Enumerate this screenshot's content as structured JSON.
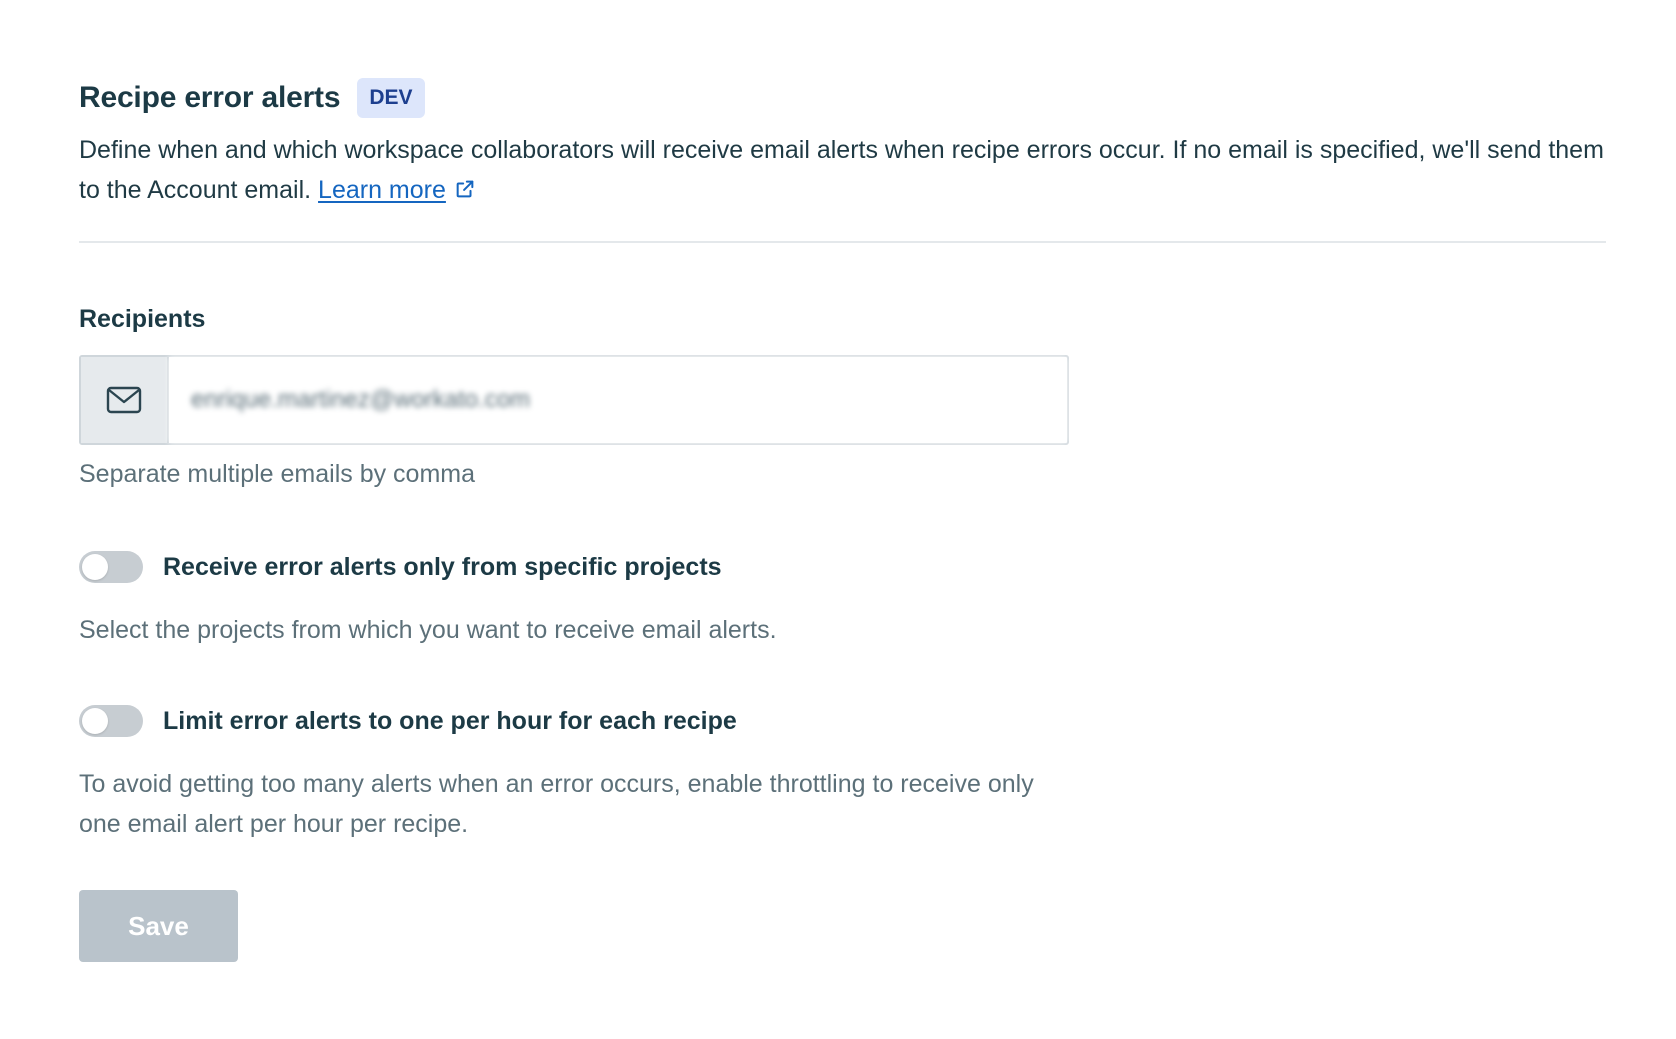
{
  "header": {
    "title": "Recipe error alerts",
    "badge": "DEV",
    "description": "Define when and which workspace collaborators will receive email alerts when recipe errors occur. If no email is specified, we'll send them to the Account email.",
    "learn_more": "Learn more"
  },
  "recipients": {
    "label": "Recipients",
    "input_value": "enrique.martinez@workato.com",
    "hint": "Separate multiple emails by comma",
    "icon": "envelope-icon"
  },
  "options": [
    {
      "label": "Receive error alerts only from specific projects",
      "help": "Select the projects from which you want to receive email alerts.",
      "enabled": false
    },
    {
      "label": "Limit error alerts to one per hour for each recipe",
      "help": "To avoid getting too many alerts when an error occurs, enable throttling to receive only one email alert per hour per recipe.",
      "enabled": false
    }
  ],
  "actions": {
    "save_label": "Save",
    "save_disabled": true
  },
  "colors": {
    "link": "#1566c0",
    "badge_bg": "#dde6fb",
    "badge_text": "#1d3f8f",
    "toggle_off": "#c7cdd2",
    "button_disabled": "#b9c3cb"
  }
}
